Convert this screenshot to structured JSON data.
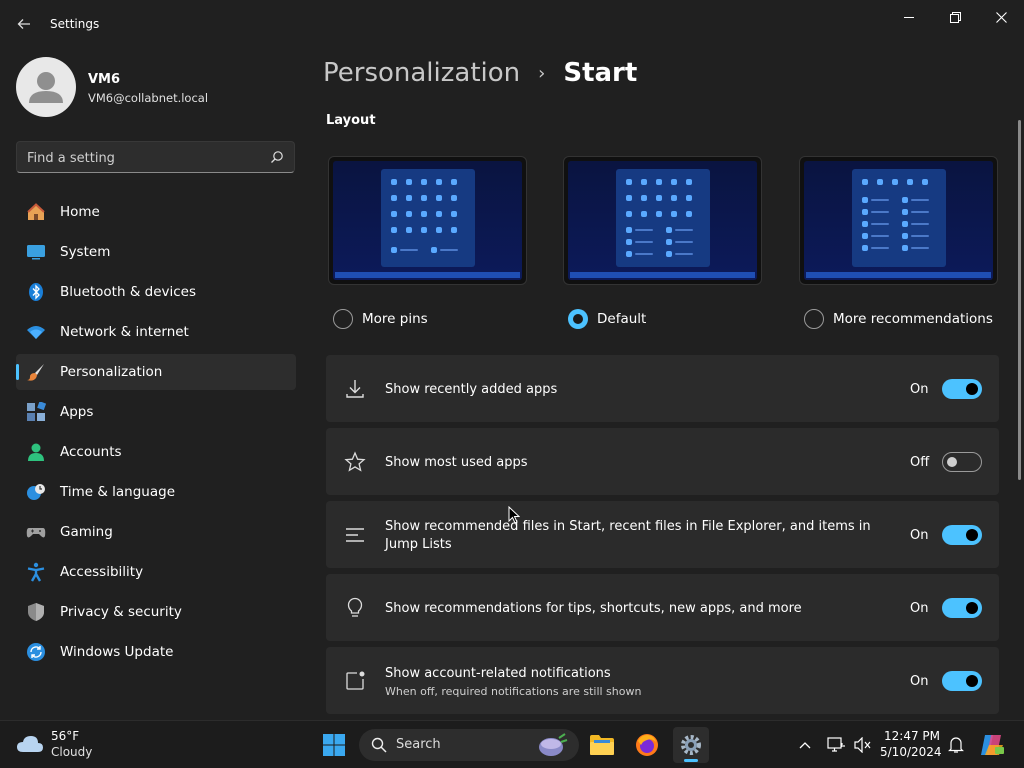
{
  "window": {
    "title": "Settings"
  },
  "user": {
    "name": "VM6",
    "email": "VM6@collabnet.local"
  },
  "search": {
    "placeholder": "Find a setting"
  },
  "sidebar": {
    "items": [
      {
        "label": "Home",
        "icon": "home-icon"
      },
      {
        "label": "System",
        "icon": "system-icon"
      },
      {
        "label": "Bluetooth & devices",
        "icon": "bluetooth-icon"
      },
      {
        "label": "Network & internet",
        "icon": "wifi-icon"
      },
      {
        "label": "Personalization",
        "icon": "brush-icon",
        "active": true
      },
      {
        "label": "Apps",
        "icon": "apps-icon"
      },
      {
        "label": "Accounts",
        "icon": "accounts-icon"
      },
      {
        "label": "Time & language",
        "icon": "clock-globe-icon"
      },
      {
        "label": "Gaming",
        "icon": "gamepad-icon"
      },
      {
        "label": "Accessibility",
        "icon": "accessibility-icon"
      },
      {
        "label": "Privacy & security",
        "icon": "shield-icon"
      },
      {
        "label": "Windows Update",
        "icon": "update-icon"
      }
    ]
  },
  "breadcrumb": {
    "parent": "Personalization",
    "separator": "›",
    "current": "Start"
  },
  "layout": {
    "heading": "Layout",
    "options": [
      {
        "label": "More pins",
        "selected": false
      },
      {
        "label": "Default",
        "selected": true
      },
      {
        "label": "More recommendations",
        "selected": false
      }
    ]
  },
  "settings": [
    {
      "label": "Show recently added apps",
      "state": "On",
      "on": true,
      "icon": "download-icon"
    },
    {
      "label": "Show most used apps",
      "state": "Off",
      "on": false,
      "icon": "star-icon"
    },
    {
      "label": "Show recommended files in Start, recent files in File Explorer, and items in Jump Lists",
      "state": "On",
      "on": true,
      "icon": "list-icon"
    },
    {
      "label": "Show recommendations for tips, shortcuts, new apps, and more",
      "state": "On",
      "on": true,
      "icon": "lightbulb-icon"
    },
    {
      "label": "Show account-related notifications",
      "sublabel": "When off, required notifications are still shown",
      "state": "On",
      "on": true,
      "icon": "notification-icon"
    }
  ],
  "taskbar": {
    "weather": {
      "temp": "56°F",
      "desc": "Cloudy"
    },
    "search_label": "Search",
    "time": "12:47 PM",
    "date": "5/10/2024"
  },
  "colors": {
    "accent": "#4cc2ff",
    "background": "#202020",
    "card": "#2b2b2b"
  }
}
